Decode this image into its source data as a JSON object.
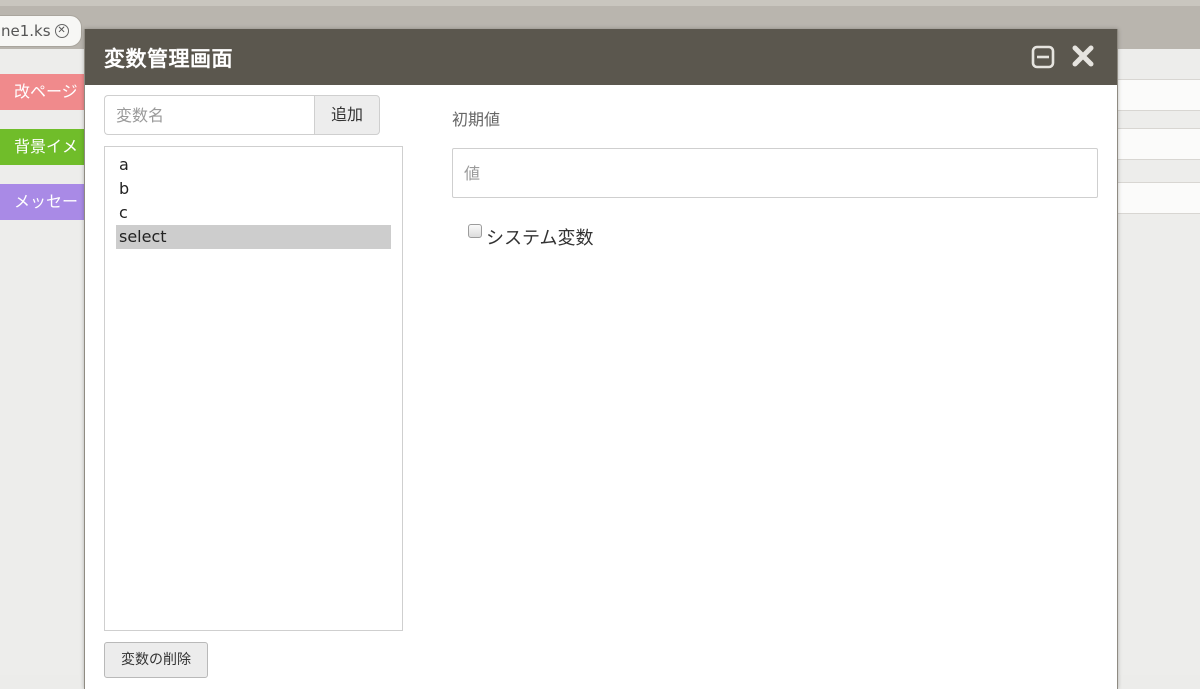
{
  "editor": {
    "file_tab": "ne1.ks",
    "commands": [
      "改ページ",
      "背景イメ",
      "メッセー"
    ]
  },
  "dialog": {
    "title": "変数管理画面",
    "icons": [
      "minimize-icon",
      "close-icon"
    ],
    "var_name_placeholder": "変数名",
    "add_label": "追加",
    "variables": [
      "a",
      "b",
      "c",
      "select"
    ],
    "selected_variable": "select",
    "delete_label": "変数の削除",
    "initial_value_label": "初期値",
    "value_placeholder": "値",
    "system_var_label": "システム変数",
    "system_var_checked": false
  },
  "colors": {
    "titlebar": "#5b574e",
    "cmd_red": "#f08a8c",
    "cmd_green": "#70bd2a",
    "cmd_purple": "#a98ae6"
  }
}
